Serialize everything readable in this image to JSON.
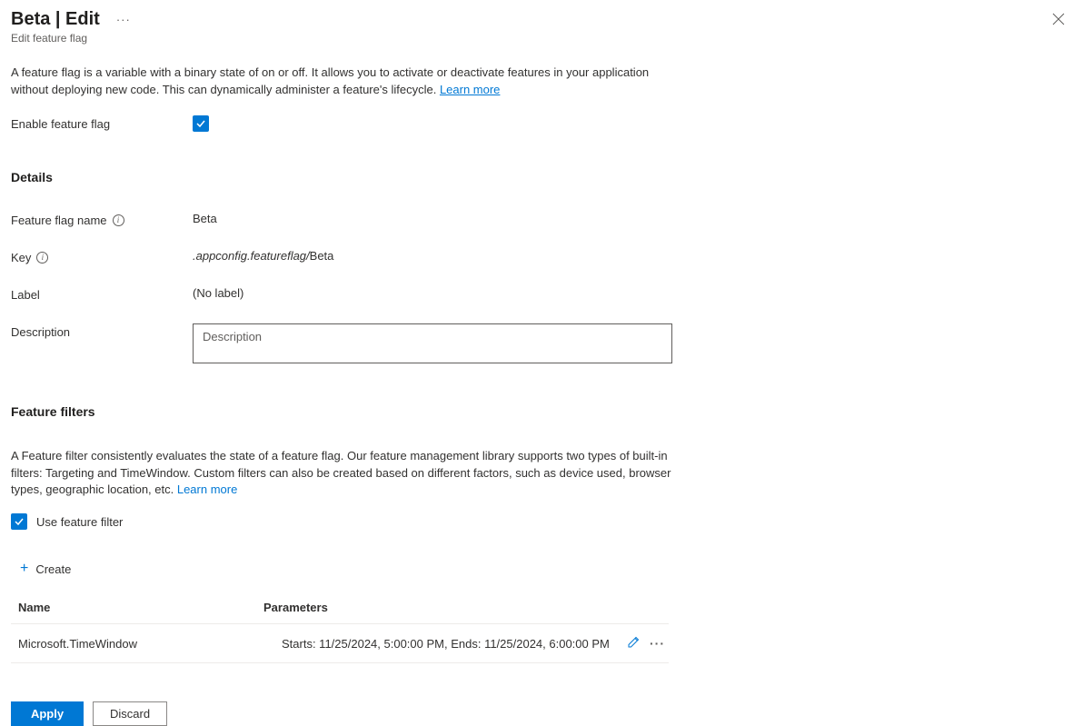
{
  "header": {
    "title": "Beta | Edit",
    "subtitle": "Edit feature flag"
  },
  "intro": {
    "text": "A feature flag is a variable with a binary state of on or off. It allows you to activate or deactivate features in your application without deploying new code. This can dynamically administer a feature's lifecycle. ",
    "learn_more": "Learn more"
  },
  "enable": {
    "label": "Enable feature flag"
  },
  "details": {
    "heading": "Details",
    "name_label": "Feature flag name",
    "name_value": "Beta",
    "key_label": "Key",
    "key_prefix": ".appconfig.featureflag/",
    "key_value": "Beta",
    "label_label": "Label",
    "label_value": "(No label)",
    "description_label": "Description",
    "description_placeholder": "Description"
  },
  "filters": {
    "heading": "Feature filters",
    "intro": "A Feature filter consistently evaluates the state of a feature flag. Our feature management library supports two types of built-in filters: Targeting and TimeWindow. Custom filters can also be created based on different factors, such as device used, browser types, geographic location, etc. ",
    "learn_more": "Learn more",
    "use_filter_label": "Use feature filter",
    "create_label": "Create",
    "table": {
      "col_name": "Name",
      "col_params": "Parameters",
      "rows": [
        {
          "name": "Microsoft.TimeWindow",
          "params": "Starts: 11/25/2024, 5:00:00 PM, Ends: 11/25/2024, 6:00:00 PM"
        }
      ]
    }
  },
  "footer": {
    "apply": "Apply",
    "discard": "Discard"
  }
}
